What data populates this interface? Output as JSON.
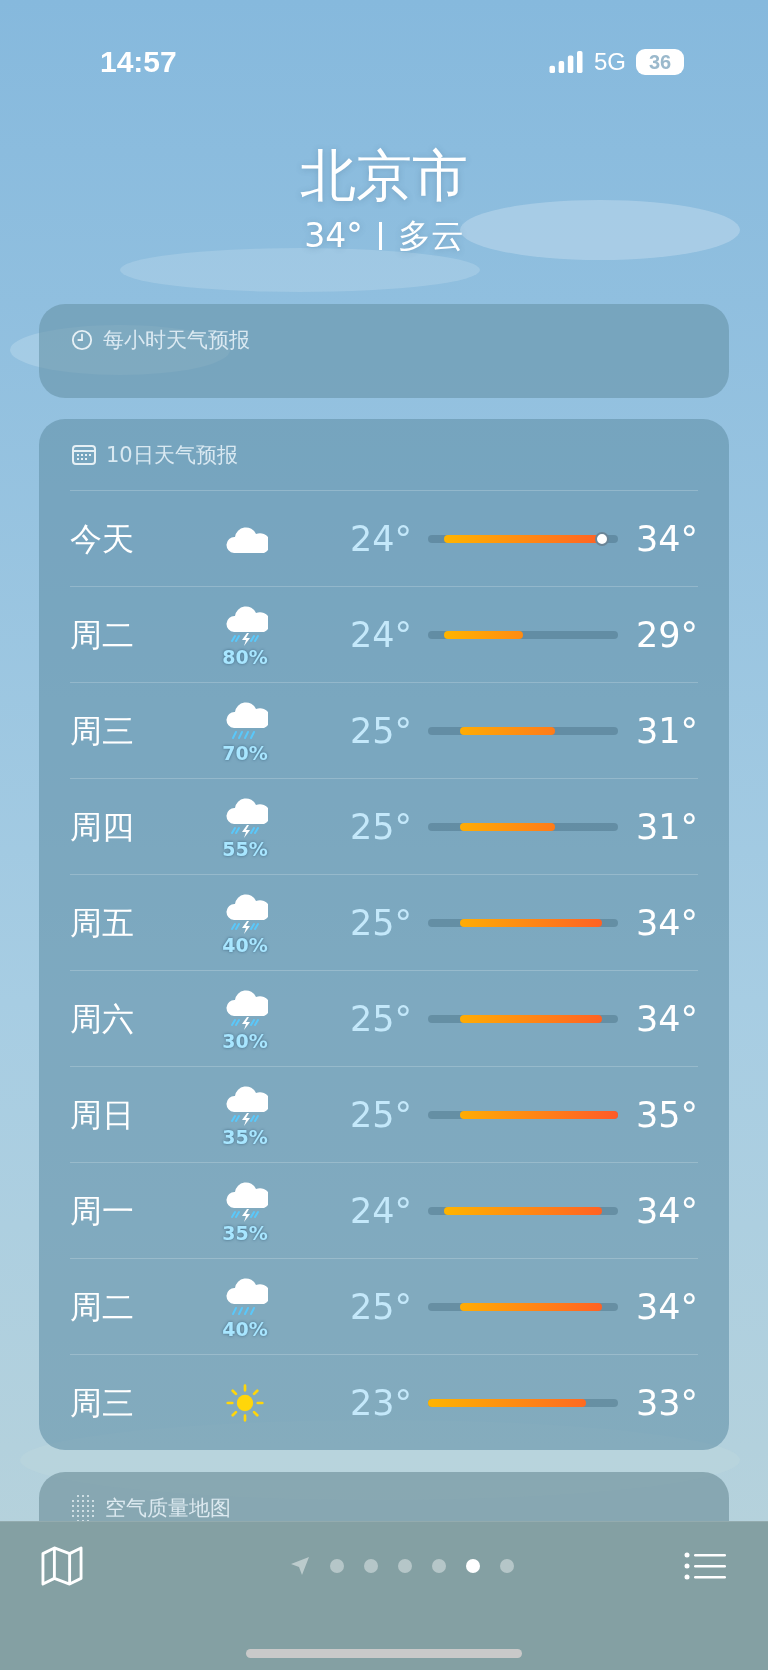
{
  "status_bar": {
    "time": "14:57",
    "network": "5G",
    "battery": "36"
  },
  "location": {
    "city": "北京市",
    "current_temp": "34°",
    "condition": "多云"
  },
  "hourly_forecast": {
    "title": "每小时天气预报"
  },
  "ten_day_forecast": {
    "title": "10日天气预报",
    "days": [
      {
        "day": "今天",
        "kind": "cloud",
        "low": "24°",
        "high": "34°",
        "now": true
      },
      {
        "day": "周二",
        "kind": "thunderstorm",
        "precipitation": "80%",
        "low": "24°",
        "high": "29°",
        "now": false
      },
      {
        "day": "周三",
        "kind": "rain",
        "precipitation": "70%",
        "low": "25°",
        "high": "31°",
        "now": false
      },
      {
        "day": "周四",
        "kind": "thunderstorm",
        "precipitation": "55%",
        "low": "25°",
        "high": "31°",
        "now": false
      },
      {
        "day": "周五",
        "kind": "thunderstorm",
        "precipitation": "40%",
        "low": "25°",
        "high": "34°",
        "now": false
      },
      {
        "day": "周六",
        "kind": "thunderstorm",
        "precipitation": "30%",
        "low": "25°",
        "high": "34°",
        "now": false
      },
      {
        "day": "周日",
        "kind": "thunderstorm",
        "precipitation": "35%",
        "low": "25°",
        "high": "35°",
        "now": false
      },
      {
        "day": "周一",
        "kind": "thunderstorm",
        "precipitation": "35%",
        "low": "24°",
        "high": "34°",
        "now": false
      },
      {
        "day": "周二",
        "kind": "rain",
        "precipitation": "40%",
        "low": "25°",
        "high": "34°",
        "now": false
      },
      {
        "day": "周三",
        "kind": "sun",
        "low": "23°",
        "high": "33°",
        "now": false
      }
    ]
  },
  "air_quality_map": {
    "title": "空气质量地图"
  },
  "bottom_bar": {
    "pages": [
      {
        "kind": "location",
        "selected": false
      },
      {
        "kind": "dot",
        "selected": false
      },
      {
        "kind": "dot",
        "selected": false
      },
      {
        "kind": "dot",
        "selected": false
      },
      {
        "kind": "dot",
        "selected": false
      },
      {
        "kind": "dot",
        "selected": true
      },
      {
        "kind": "dot",
        "selected": false
      }
    ]
  }
}
